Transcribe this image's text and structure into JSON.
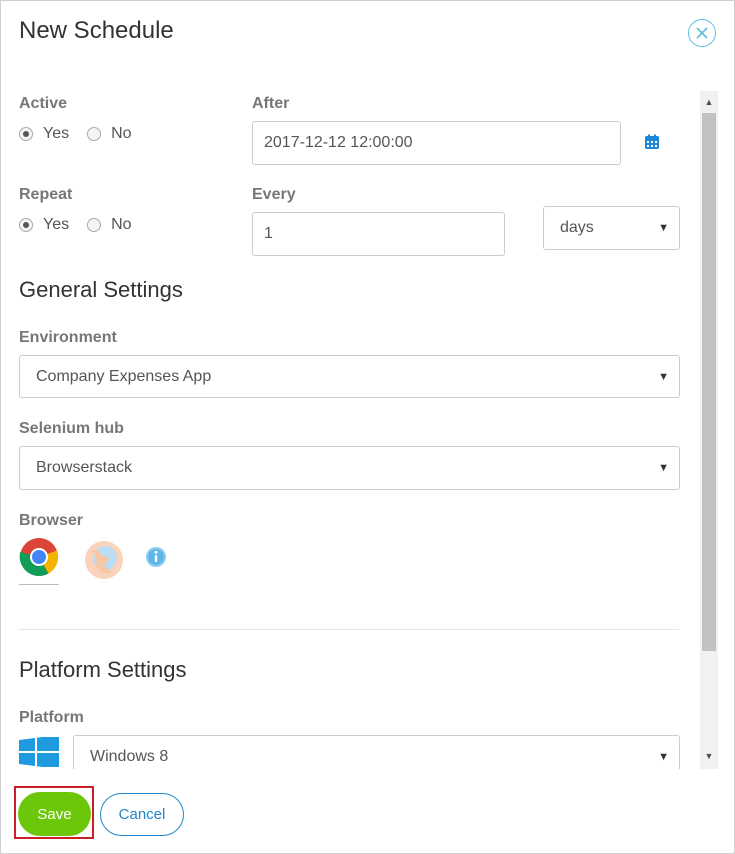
{
  "dialog": {
    "title": "New Schedule",
    "close_icon": "close-circle-icon"
  },
  "active": {
    "label": "Active",
    "options": [
      "Yes",
      "No"
    ],
    "selected": "Yes"
  },
  "after": {
    "label": "After",
    "value": "2017-12-12 12:00:00",
    "calendar_icon": "calendar-icon"
  },
  "repeat": {
    "label": "Repeat",
    "options": [
      "Yes",
      "No"
    ],
    "selected": "Yes"
  },
  "every": {
    "label": "Every",
    "value": "1",
    "unit": "days"
  },
  "general_settings": {
    "title": "General Settings",
    "environment": {
      "label": "Environment",
      "value": "Company Expenses App"
    },
    "selenium_hub": {
      "label": "Selenium hub",
      "value": "Browserstack"
    },
    "browser": {
      "label": "Browser",
      "options": [
        "chrome-icon",
        "firefox-icon"
      ],
      "selected": "chrome-icon",
      "info_icon": "info-icon"
    }
  },
  "platform_settings": {
    "title": "Platform Settings",
    "platform": {
      "label": "Platform",
      "value": "Windows 8",
      "icon": "windows-icon"
    }
  },
  "footer": {
    "save_label": "Save",
    "cancel_label": "Cancel"
  },
  "colors": {
    "accent": "#5bc0de",
    "save_green": "#6cc70a",
    "calendar_blue": "#1e88d8",
    "highlight_red": "#c8202a"
  }
}
